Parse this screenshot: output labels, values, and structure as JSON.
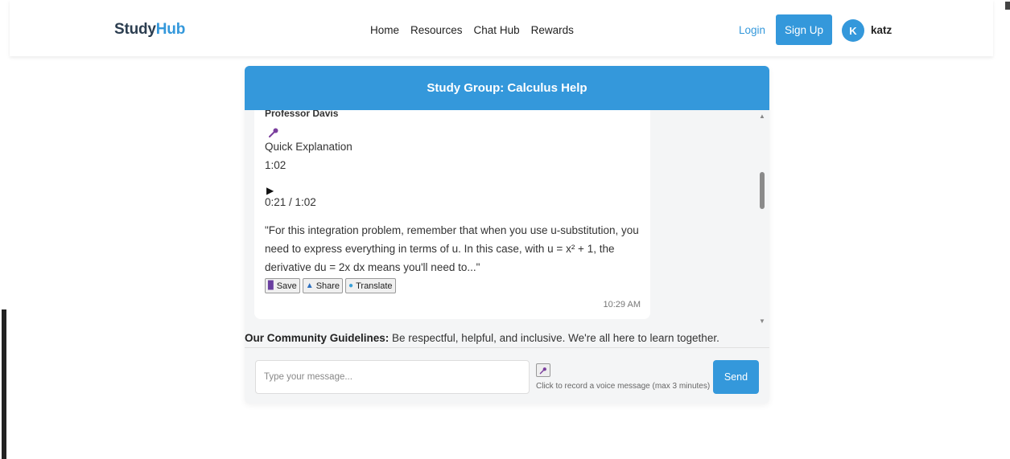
{
  "header": {
    "logo_part1": "Study",
    "logo_part2": "Hub",
    "nav": [
      "Home",
      "Resources",
      "Chat Hub",
      "Rewards"
    ],
    "login_label": "Login",
    "signup_label": "Sign Up",
    "avatar_initial": "K",
    "username": "katz"
  },
  "chat": {
    "title": "Study Group: Calculus Help",
    "message": {
      "sender": "Professor Davis",
      "mic_icon": "microphone-icon",
      "audio_title": "Quick Explanation",
      "duration": "1:02",
      "progress": "0:21 / 1:02",
      "transcript": "\"For this integration problem, remember that when you use u-substitution, you need to express everything in terms of u. In this case, with u = x² + 1, the derivative du = 2x dx means you'll need to...\"",
      "actions": {
        "save": "Save",
        "share": "Share",
        "translate": "Translate"
      },
      "time": "10:29 AM"
    }
  },
  "guidelines": {
    "label": "Our Community Guidelines:",
    "text": " Be respectful, helpful, and inclusive. We're all here to learn together."
  },
  "composer": {
    "placeholder": "Type your message...",
    "record_hint": "Click to record a voice message (max 3 minutes)",
    "send_label": "Send"
  },
  "colors": {
    "accent": "#3498db",
    "logo_dark": "#2c3e50"
  }
}
